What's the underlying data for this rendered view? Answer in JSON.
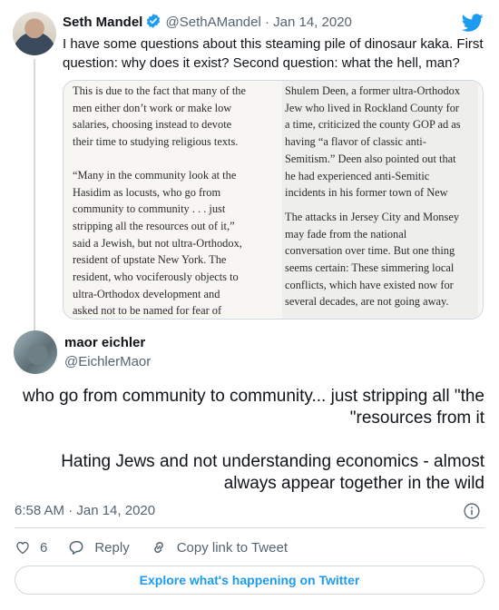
{
  "quoted_tweet": {
    "author_name": "Seth Mandel",
    "handle_date": "@SethAMandel · Jan 14, 2020",
    "text": "I have some questions about this steaming pile of dinosaur kaka. First question: why does it exist? Second question: what the hell, man?",
    "image": {
      "left_column": [
        "This is due to the fact that many of the\nmen either don’t work or make low\nsalaries, choosing instead to devote\ntheir time to studying religious texts.",
        "“Many in the community look at the\nHasidim as locusts, who go from\ncommunity to community . . . just\nstripping all the resources out of it,”\nsaid a Jewish, but not ultra-Orthodox,\nresident of upstate New York. The\nresident, who vociferously objects to\nultra-Orthodox development and\nasked not to be named for fear of"
      ],
      "right_column": [
        "Shulem Deen, a former ultra-Orthodox\nJew who lived in Rockland County for\na time, criticized the county GOP ad as\nhaving “a flavor of classic anti-\nSemitism.” Deen also pointed out that\nhe had experienced anti-Semitic\nincidents in his former town of New",
        "The attacks in Jersey City and Monsey\nmay fade from the national\nconversation over time. But one thing\nseems certain: These simmering local\nconflicts, which have existed now for\nseveral decades, are not going away."
      ]
    }
  },
  "main_tweet": {
    "author_name": "maor eichler",
    "handle": "@EichlerMaor",
    "paragraphs": [
      "who go from community to community... just stripping all \"the resources from it\"",
      "Hating Jews and not understanding economics - almost always appear together in the wild"
    ],
    "timestamp": "6:58 AM · Jan 14, 2020"
  },
  "actions": {
    "like_count": "6",
    "reply_label": "Reply",
    "copy_link_label": "Copy link to Tweet"
  },
  "explore_button_label": "Explore what's happening on Twitter",
  "colors": {
    "accent": "#1d9bf0",
    "secondary_text": "#536471",
    "border": "#cfd9de"
  },
  "icons": [
    "verified-badge-icon",
    "twitter-bird-icon",
    "info-icon",
    "heart-icon",
    "reply-icon",
    "link-icon"
  ]
}
